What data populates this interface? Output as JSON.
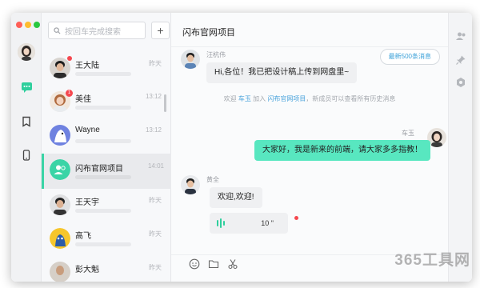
{
  "search": {
    "placeholder": "按回车完成搜索"
  },
  "add_button": "+",
  "conversations": [
    {
      "name": "王大陆",
      "time": "昨天",
      "badge": ""
    },
    {
      "name": "美佳",
      "time": "13:12",
      "badge": "1"
    },
    {
      "name": "Wayne",
      "time": "13:12",
      "badge": ""
    },
    {
      "name": "闪布官网项目",
      "time": "14:01",
      "badge": ""
    },
    {
      "name": "王天宇",
      "time": "昨天",
      "badge": ""
    },
    {
      "name": "高飞",
      "time": "昨天",
      "badge": ""
    },
    {
      "name": "彭大魁",
      "time": "昨天",
      "badge": ""
    }
  ],
  "chat": {
    "title": "闪布官网项目",
    "new_messages_button": "最新500条消息",
    "messages": [
      {
        "sender": "汪杭伟",
        "text": "Hi,各位！我已把设计稿上传到网盘里~"
      },
      {
        "sender": "车玉",
        "text": "大家好，我是新来的前端，请大家多多指教！"
      },
      {
        "sender": "黄全",
        "text": "欢迎,欢迎!"
      }
    ],
    "notice": {
      "prefix": "欢迎",
      "user": "车玉",
      "mid": "加入",
      "group": "闪布官网项目",
      "suffix": "，新成员可以查看所有历史消息"
    },
    "voice": {
      "duration": "10 \""
    }
  },
  "watermark": "365工具网",
  "colors": {
    "accent": "#58e7c0",
    "badge": "#f5484f",
    "link": "#4aa3db"
  }
}
